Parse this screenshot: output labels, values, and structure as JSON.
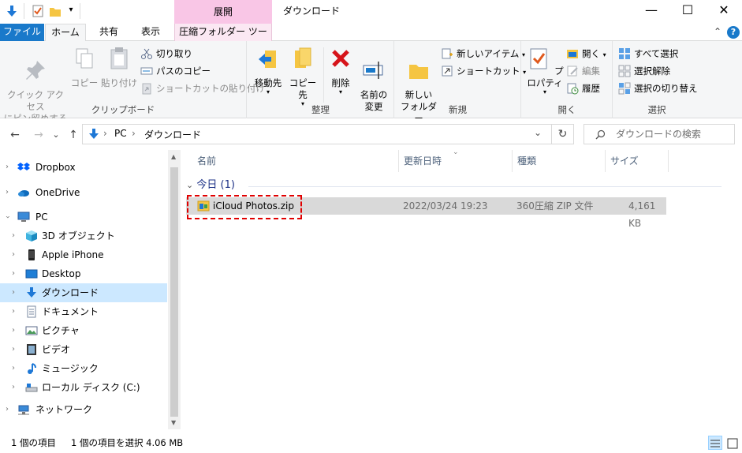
{
  "titlebar": {
    "context_tab": "展開",
    "title": "ダウンロード",
    "minimize": "—",
    "maximize": "☐",
    "close": "✕"
  },
  "tabs": {
    "file": "ファイル",
    "home": "ホーム",
    "share": "共有",
    "view": "表示",
    "compressed_tools": "圧縮フォルダー ツール",
    "expand": "⌃",
    "help": "?"
  },
  "ribbon": {
    "clipboard": {
      "label": "クリップボード",
      "pin": "クイック アクセス\nにピン留めする",
      "copy": "コピー",
      "paste": "貼り付け",
      "cut": "切り取り",
      "copy_path": "パスのコピー",
      "paste_shortcut": "ショートカットの貼り付け"
    },
    "organize": {
      "label": "整理",
      "move_to": "移動先",
      "copy_to": "コピー先",
      "delete": "削除",
      "rename": "名前の\n変更"
    },
    "new": {
      "label": "新規",
      "new_folder": "新しい\nフォルダー",
      "new_item": "新しいアイテム",
      "shortcut": "ショートカット"
    },
    "open": {
      "label": "開く",
      "properties": "プロパティ",
      "open": "開く",
      "edit": "編集",
      "history": "履歴"
    },
    "select": {
      "label": "選択",
      "select_all": "すべて選択",
      "select_none": "選択解除",
      "invert": "選択の切り替え"
    }
  },
  "address": {
    "back": "←",
    "forward": "→",
    "recent": "⌄",
    "up": "↑",
    "path": [
      "PC",
      "ダウンロード"
    ],
    "separator": "›",
    "dropdown": "⌄",
    "refresh": "↻",
    "search_placeholder": "ダウンロードの検索"
  },
  "nav": {
    "items": [
      {
        "label": "Dropbox",
        "icon": "dropbox-icon"
      },
      {
        "label": "OneDrive",
        "icon": "cloud-icon"
      },
      {
        "label": "PC",
        "icon": "computer-icon"
      },
      {
        "label": "3D オブジェクト",
        "icon": "cube-icon"
      },
      {
        "label": "Apple iPhone",
        "icon": "phone-icon"
      },
      {
        "label": "Desktop",
        "icon": "desktop-icon"
      },
      {
        "label": "ダウンロード",
        "icon": "download-icon"
      },
      {
        "label": "ドキュメント",
        "icon": "document-icon"
      },
      {
        "label": "ピクチャ",
        "icon": "picture-icon"
      },
      {
        "label": "ビデオ",
        "icon": "video-icon"
      },
      {
        "label": "ミュージック",
        "icon": "music-icon"
      },
      {
        "label": "ローカル ディスク (C:)",
        "icon": "disk-icon"
      },
      {
        "label": "ネットワーク",
        "icon": "network-icon"
      }
    ]
  },
  "filelist": {
    "columns": {
      "name": "名前",
      "modified": "更新日時",
      "type": "種類",
      "size": "サイズ"
    },
    "group": "今日 (1)",
    "files": [
      {
        "name": "iCloud Photos.zip",
        "modified": "2022/03/24 19:23",
        "type": "360圧縮 ZIP 文件",
        "size": "4,161 KB"
      }
    ]
  },
  "status": {
    "count": "1 個の項目",
    "selected": "1 個の項目を選択  4.06 MB"
  },
  "colors": {
    "accent": "#1979ca",
    "selection": "#cce8ff",
    "highlight_dash": "#e00000",
    "context_tab": "#f9c6e6"
  }
}
